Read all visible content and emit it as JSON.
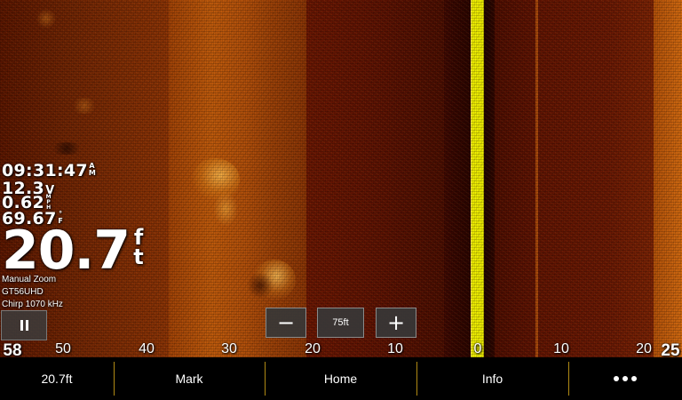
{
  "overlay": {
    "time": {
      "value": "09:31:47",
      "unit_top": "A",
      "unit_bottom": "M"
    },
    "voltage": {
      "value": "12.3",
      "unit": "V"
    },
    "speed": {
      "value": "0.62",
      "unit_top": "M",
      "unit_mid": "P",
      "unit_bottom": "H"
    },
    "temperature": {
      "value": "69.67",
      "unit_top": "°",
      "unit_bottom": "F"
    },
    "depth": {
      "value": "20.7",
      "unit_top": "f",
      "unit_bottom": "t"
    },
    "zoom_mode": "Manual Zoom",
    "transducer": "GT56UHD",
    "frequency": "Chirp 1070 kHz"
  },
  "zoom": {
    "minus": "−",
    "level": "75ft",
    "plus": "+"
  },
  "range_scale": [
    "58",
    "50",
    "40",
    "30",
    "20",
    "10",
    "0",
    "10",
    "20",
    "25"
  ],
  "bottom_bar": {
    "depth_label": "20.7ft",
    "mark_label": "Mark",
    "home_label": "Home",
    "info_label": "Info"
  },
  "colors": {
    "center_line": "#f2f200",
    "sonar_dark": "#3a0700",
    "sonar_bright": "#d46a10",
    "divider": "#b08a14"
  },
  "icons": {
    "pause": "pause-icon",
    "more": "more-dots-icon"
  }
}
